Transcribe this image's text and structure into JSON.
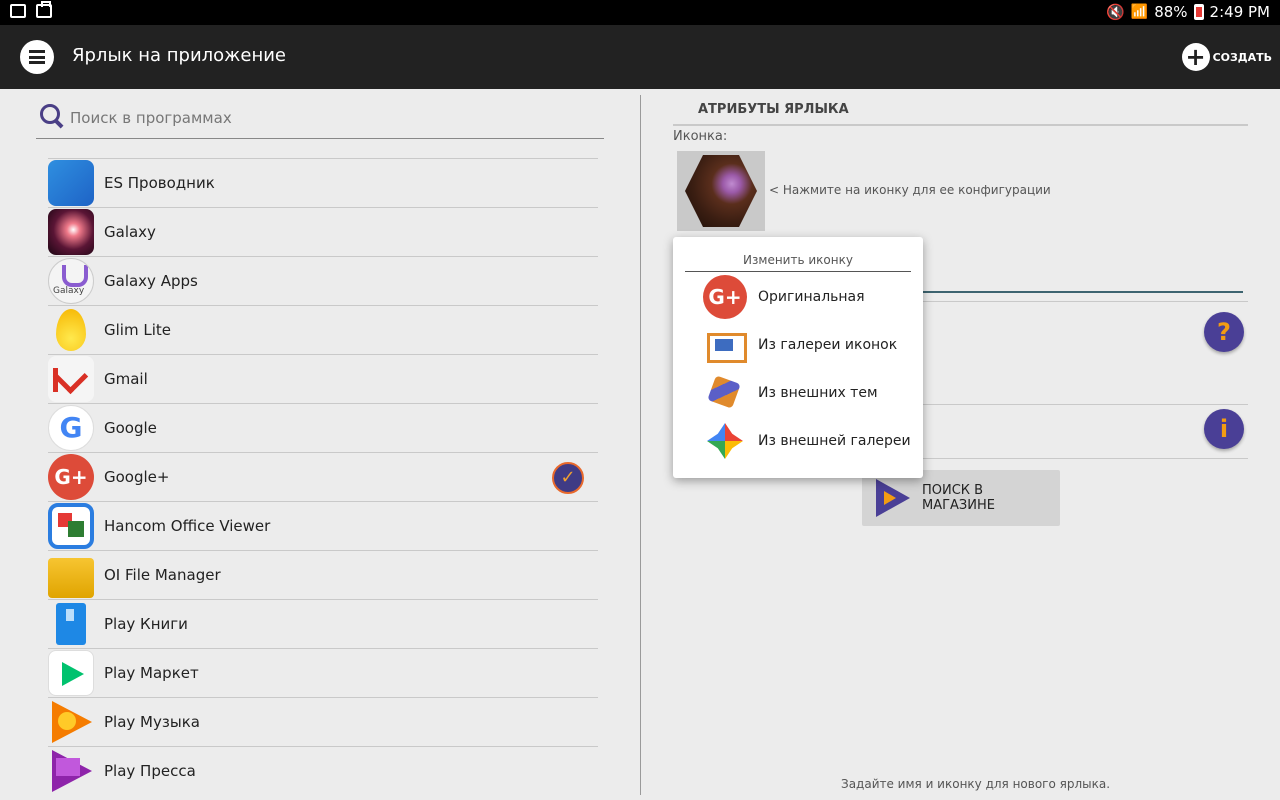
{
  "status_bar": {
    "battery": "88%",
    "time": "2:49 PM"
  },
  "app_bar": {
    "title": "Ярлык на приложение",
    "create_label": "СОЗДАТЬ"
  },
  "search": {
    "placeholder": "Поиск в программах"
  },
  "apps": [
    {
      "name": "ES Проводник",
      "icon": "es-explorer-icon"
    },
    {
      "name": "Galaxy",
      "icon": "galaxy-icon"
    },
    {
      "name": "Galaxy Apps",
      "icon": "galaxy-apps-icon",
      "icon_text": "Galaxy"
    },
    {
      "name": "Glim Lite",
      "icon": "glim-lite-icon"
    },
    {
      "name": "Gmail",
      "icon": "gmail-icon"
    },
    {
      "name": "Google",
      "icon": "google-icon",
      "icon_text": "G"
    },
    {
      "name": "Google+",
      "icon": "google-plus-icon",
      "icon_text": "G+",
      "selected": true
    },
    {
      "name": "Hancom Office Viewer",
      "icon": "hancom-icon"
    },
    {
      "name": "OI File Manager",
      "icon": "folder-icon"
    },
    {
      "name": "Play Книги",
      "icon": "play-books-icon"
    },
    {
      "name": "Play Маркет",
      "icon": "play-market-icon"
    },
    {
      "name": "Play Музыка",
      "icon": "play-music-icon"
    },
    {
      "name": "Play Пресса",
      "icon": "play-press-icon"
    }
  ],
  "attributes": {
    "header": "АТРИБУТЫ ЯРЛЫКА",
    "icon_label": "Иконка:",
    "icon_hint": "< Нажмите на иконку для ее конфигурации",
    "help_button": "?",
    "info_button": "i",
    "store_button": "ПОИСК В МАГАЗИНЕ",
    "footer_hint": "Задайте имя и иконку для нового ярлыка."
  },
  "popup": {
    "title": "Изменить иконку",
    "items": [
      {
        "label": "Оригинальная",
        "icon": "google-plus-icon",
        "icon_text": "G+"
      },
      {
        "label": "Из галереи иконок",
        "icon": "gallery-icon"
      },
      {
        "label": "Из внешних тем",
        "icon": "themes-icon"
      },
      {
        "label": "Из внешней галереи",
        "icon": "photos-icon"
      }
    ]
  },
  "colors": {
    "accent": "#4a3f96",
    "accent_secondary": "#f39c12",
    "appbar": "#222222"
  }
}
